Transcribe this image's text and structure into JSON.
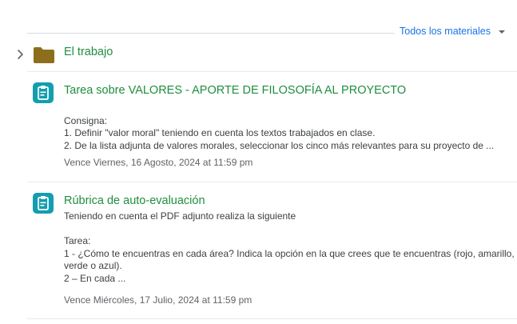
{
  "filter": {
    "label": "Todos los materiales"
  },
  "topic": {
    "title": "El trabajo"
  },
  "items": [
    {
      "title": "Tarea sobre VALORES - APORTE DE FILOSOFÍA AL PROYECTO",
      "lines": [
        "",
        "Consigna:",
        "1.  Definir \"valor moral\" teniendo en cuenta los textos trabajados en clase.",
        "2.  De la lista adjunta de valores morales, seleccionar los cinco más relevantes para su proyecto de ..."
      ],
      "due": "Vence Viernes, 16 Agosto, 2024 at 11:59 pm"
    },
    {
      "title": "Rúbrica de auto-evaluación",
      "lines": [
        "Teniendo en cuenta el PDF adjunto realiza la siguiente",
        "",
        "Tarea:",
        "1 - ¿Cómo te encuentras en cada área? Indica la opción en la que crees que te encuentras (rojo, amarillo,",
        "verde o azul).",
        "2 – En cada ..."
      ],
      "due": "Vence Miércoles, 17 Julio, 2024 at 11:59 pm"
    }
  ],
  "colors": {
    "accent": "#1e8e3e",
    "icon_bg": "#129eaf",
    "folder": "#8d6e1c",
    "link": "#1a73e8"
  }
}
